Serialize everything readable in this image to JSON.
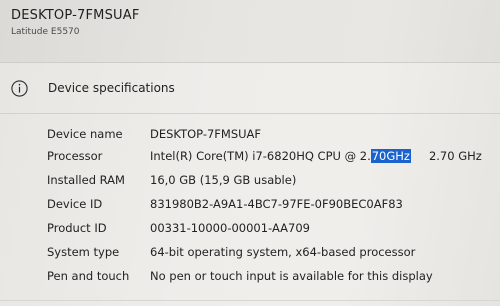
{
  "header": {
    "device_name": "DESKTOP-7FMSUAF",
    "model": "Latitude E5570"
  },
  "section": {
    "title": "Device specifications",
    "icon": "info-icon"
  },
  "specs": [
    {
      "label": "Device name",
      "value": "DESKTOP-7FMSUAF"
    },
    {
      "label": "Processor",
      "value_prefix": "Intel(R) Core(TM) i7-6820HQ CPU @ 2.",
      "value_selected": "70GHz",
      "value_suffix": "2.70 GHz"
    },
    {
      "label": "Installed RAM",
      "value": "16,0 GB (15,9 GB usable)"
    },
    {
      "label": "Device ID",
      "value": "831980B2-A9A1-4BC7-97FE-0F90BEC0AF83"
    },
    {
      "label": "Product ID",
      "value": "00331-10000-00001-AA709"
    },
    {
      "label": "System type",
      "value": "64-bit operating system, x64-based processor"
    },
    {
      "label": "Pen and touch",
      "value": "No pen or touch input is available for this display"
    }
  ],
  "colors": {
    "selection": "#1a63cf",
    "background": "#e3e1dd"
  }
}
